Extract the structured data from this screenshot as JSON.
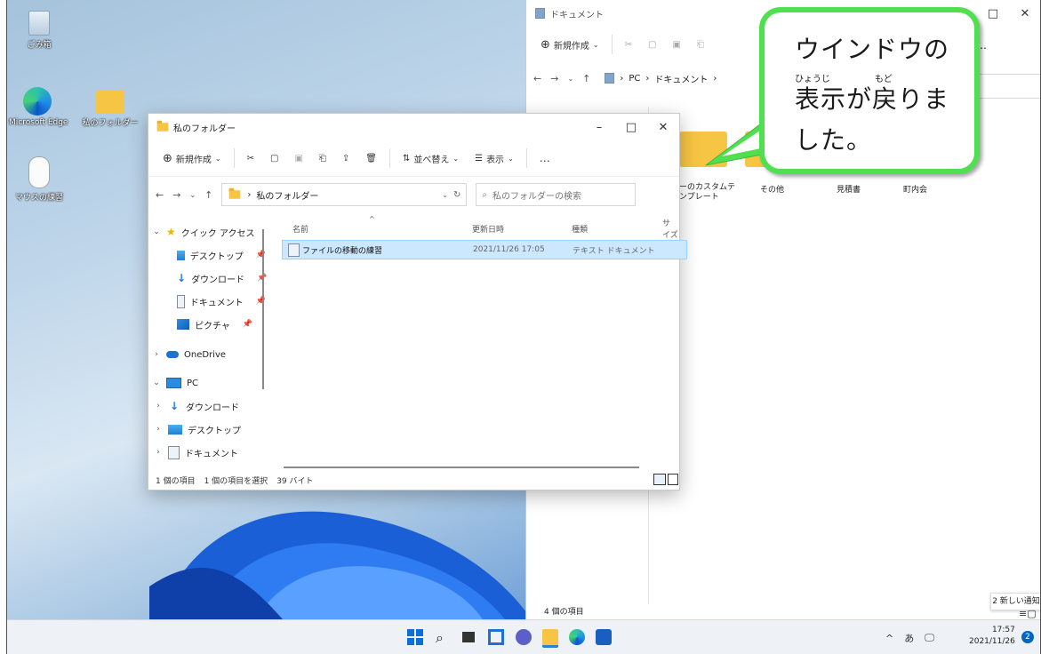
{
  "desktop": {
    "icons": [
      {
        "label": "ごみ箱",
        "icon": "recycle-bin-icon"
      },
      {
        "label": "Microsoft Edge",
        "icon": "edge-icon"
      },
      {
        "label": "私のフォルダー",
        "icon": "folder-icon"
      },
      {
        "label": "マウスの練習",
        "icon": "mouse-icon"
      }
    ]
  },
  "back_window": {
    "title": "ドキュメント",
    "new_label": "新規作成",
    "more": "…",
    "address": {
      "pc": "PC",
      "folder": "ドキュメント"
    },
    "folders": [
      "ーのカスタムテンプレート",
      "その他",
      "見積書",
      "町内会"
    ],
    "status": "4 個の項目",
    "controls": {
      "minimize": "–",
      "maximize": "□",
      "close": "✕"
    }
  },
  "front_window": {
    "title": "私のフォルダー",
    "controls": {
      "minimize": "–",
      "maximize": "□",
      "close": "✕"
    },
    "toolbar": {
      "new_label": "新規作成",
      "sort_label": "並べ替え",
      "view_label": "表示",
      "more": "…"
    },
    "address": {
      "folder": "私のフォルダー"
    },
    "search_placeholder": "私のフォルダーの検索",
    "nav": {
      "quick_access": "クイック アクセス",
      "quick_items": [
        "デスクトップ",
        "ダウンロード",
        "ドキュメント",
        "ピクチャ"
      ],
      "onedrive": "OneDrive",
      "pc": "PC",
      "pc_items": [
        "ダウンロード",
        "デスクトップ",
        "ドキュメント"
      ]
    },
    "columns": [
      "名前",
      "更新日時",
      "種類",
      "サイズ"
    ],
    "files": [
      {
        "name": "ファイルの移動の練習",
        "modified": "2021/11/26 17:05",
        "type": "テキスト ドキュメント"
      }
    ],
    "status": {
      "count": "1 個の項目",
      "selected": "1 個の項目を選択",
      "size": "39 バイト"
    }
  },
  "callout": {
    "line1": "ウインドウの",
    "line2": "表示が戻りま",
    "line3": "した。",
    "ruby1": "ひょうじ",
    "ruby2": "もど"
  },
  "notification": {
    "text": "2 新しい通知"
  },
  "taskbar": {
    "apps": [
      "start-icon",
      "search-icon",
      "task-view-icon",
      "widgets-icon",
      "chat-icon",
      "file-explorer-icon",
      "edge-icon",
      "store-icon"
    ],
    "tray": {
      "chevron": "^",
      "ime": "あ",
      "time": "17:57",
      "date": "2021/11/26",
      "badge": "2"
    }
  },
  "colors": {
    "callout_border": "#4fe04f",
    "selection": "#cce8ff",
    "accent": "#0067c0"
  }
}
